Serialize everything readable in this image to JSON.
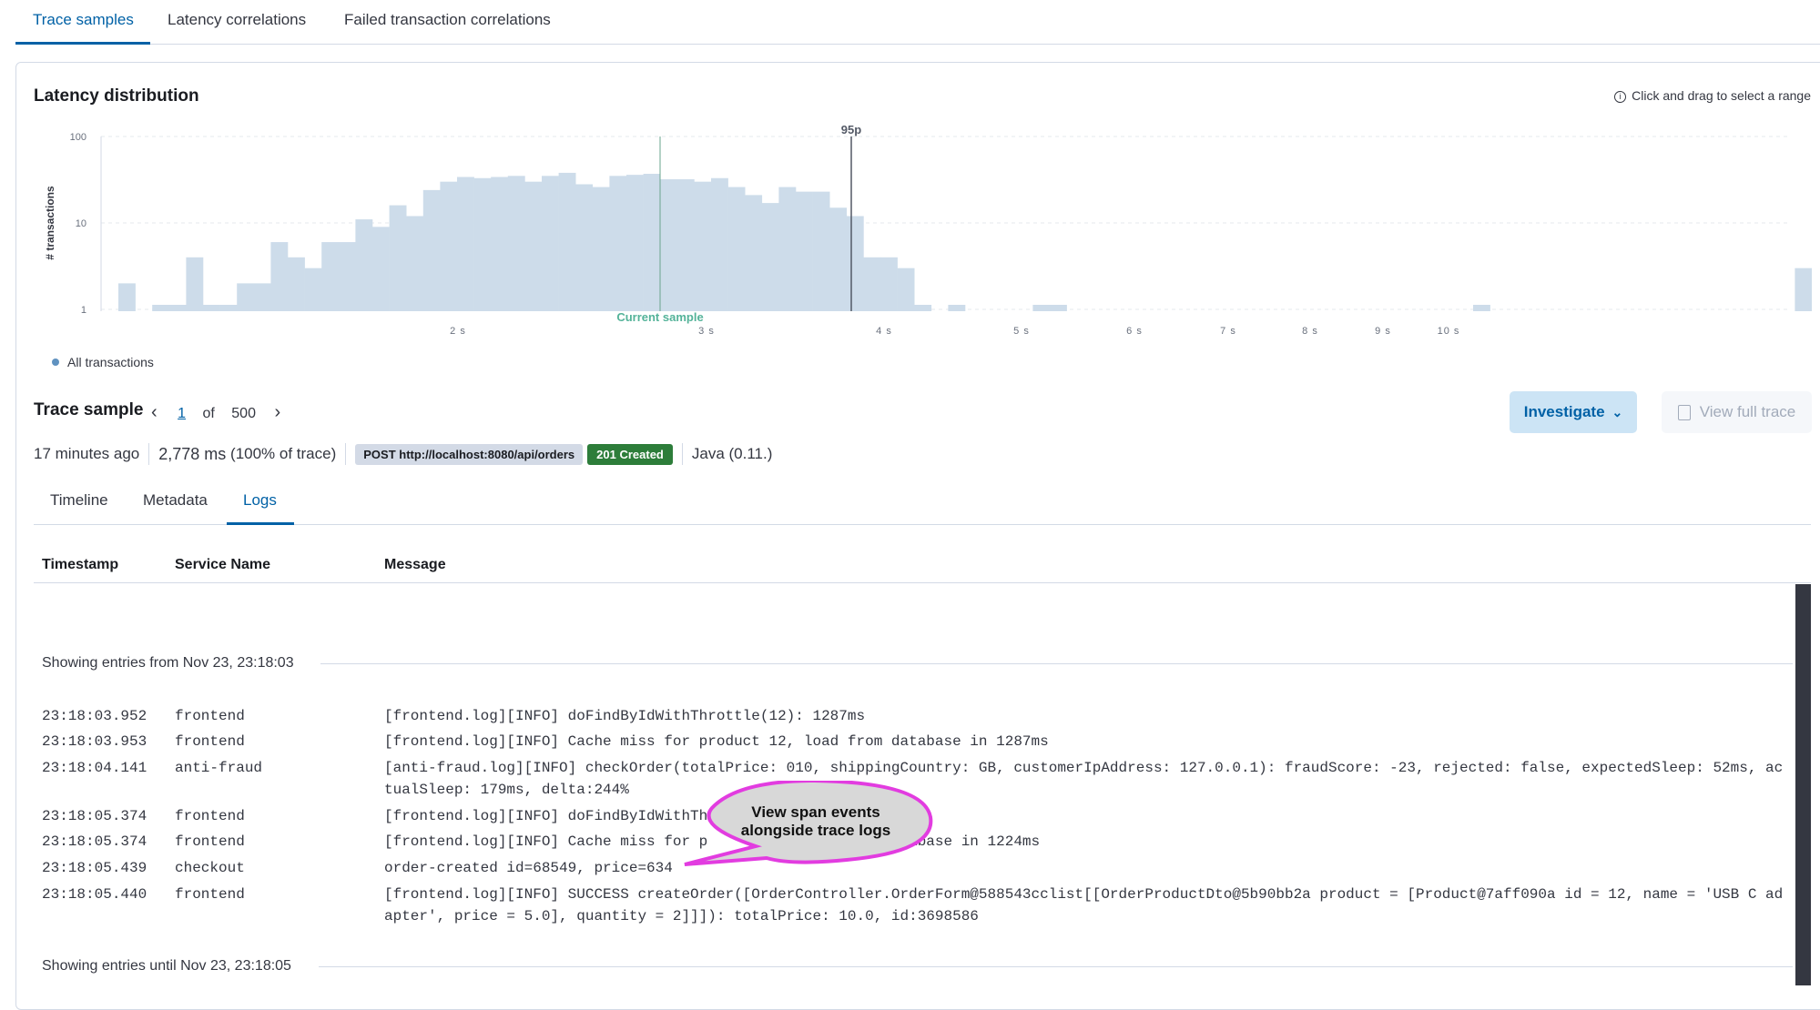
{
  "tabs": [
    "Trace samples",
    "Latency correlations",
    "Failed transaction correlations"
  ],
  "latency": {
    "title": "Latency distribution",
    "hint": "Click and drag to select a range"
  },
  "chart_data": {
    "type": "bar",
    "title": "Latency distribution",
    "ylabel": "# transactions",
    "xlabel": "",
    "y_scale": "log",
    "y_ticks": [
      "100",
      "10",
      "1"
    ],
    "x_ticks": [
      "2 s",
      "3 s",
      "4 s",
      "5 s",
      "6 s",
      "7 s",
      "8 s",
      "9 s",
      "10 s"
    ],
    "annotations": {
      "percentile": "95p",
      "current": "Current sample"
    },
    "legend": [
      "All transactions"
    ],
    "series": [
      {
        "name": "All transactions",
        "values": [
          2,
          0,
          1,
          1,
          4,
          1,
          1,
          2,
          2,
          6,
          4,
          3,
          6,
          6,
          11,
          9,
          16,
          12,
          24,
          30,
          34,
          33,
          34,
          35,
          30,
          35,
          38,
          28,
          26,
          35,
          36,
          37,
          32,
          32,
          30,
          33,
          26,
          21,
          17,
          26,
          23,
          23,
          15,
          12,
          4,
          4,
          3,
          1,
          0,
          1,
          0,
          0,
          0,
          0,
          1,
          1,
          0,
          0,
          0,
          0,
          0,
          0,
          0,
          0,
          0,
          0,
          0,
          0,
          0,
          0,
          0,
          0,
          0,
          0,
          0,
          0,
          0,
          0,
          0,
          0,
          1,
          0,
          0,
          0,
          0,
          0,
          0,
          0,
          0,
          0,
          0,
          0,
          0,
          0,
          0,
          0,
          0,
          0,
          0,
          3
        ],
        "values_note_omit": true
      }
    ]
  },
  "legend_label": "All transactions",
  "trace": {
    "title": "Trace sample",
    "page": "1",
    "of": "of",
    "total": "500",
    "investigate": "Investigate",
    "view_full": "View full trace",
    "age": "17 minutes ago",
    "duration": "2,778 ms",
    "duration_pct": "(100% of trace)",
    "url": "POST http://localhost:8080/api/orders",
    "status": "201 Created",
    "agent": "Java (0.11.)"
  },
  "subtabs": [
    "Timeline",
    "Metadata",
    "Logs"
  ],
  "logs": {
    "columns": [
      "Timestamp",
      "Service Name",
      "Message"
    ],
    "from_text": "Showing entries from Nov 23, 23:18:03",
    "until_text": "Showing entries until Nov 23, 23:18:05",
    "rows": [
      {
        "t": "23:18:03.952",
        "s": "frontend",
        "m": "[frontend.log][INFO] doFindByIdWithThrottle(12): 1287ms"
      },
      {
        "t": "23:18:03.953",
        "s": "frontend",
        "m": "[frontend.log][INFO] Cache miss for product 12, load from database in 1287ms"
      },
      {
        "t": "23:18:04.141",
        "s": "anti-fraud",
        "m": "[anti-fraud.log][INFO] checkOrder(totalPrice: 010, shippingCountry: GB, customerIpAddress: 127.0.0.1): fraudScore: -23, rejected: false, expectedSleep: 52ms, actualSleep: 179ms, delta:244%"
      },
      {
        "t": "23:18:05.374",
        "s": "frontend",
        "m": "[frontend.log][INFO] doFindByIdWithTh"
      },
      {
        "t": "23:18:05.374",
        "s": "frontend",
        "m": "[frontend.log][INFO] Cache miss for p                    database in 1224ms"
      },
      {
        "t": "23:18:05.439",
        "s": "checkout",
        "m": "order-created id=68549, price=634"
      },
      {
        "t": "23:18:05.440",
        "s": "frontend",
        "m": "[frontend.log][INFO] SUCCESS createOrder([OrderController.OrderForm@588543cclist[[OrderProductDto@5b90bb2a product = [Product@7aff090a id = 12, name = 'USB C adapter', price = 5.0], quantity = 2]]]): totalPrice: 10.0, id:3698586"
      }
    ]
  },
  "callout": {
    "line1": "View span events",
    "line2": "alongside trace logs"
  }
}
